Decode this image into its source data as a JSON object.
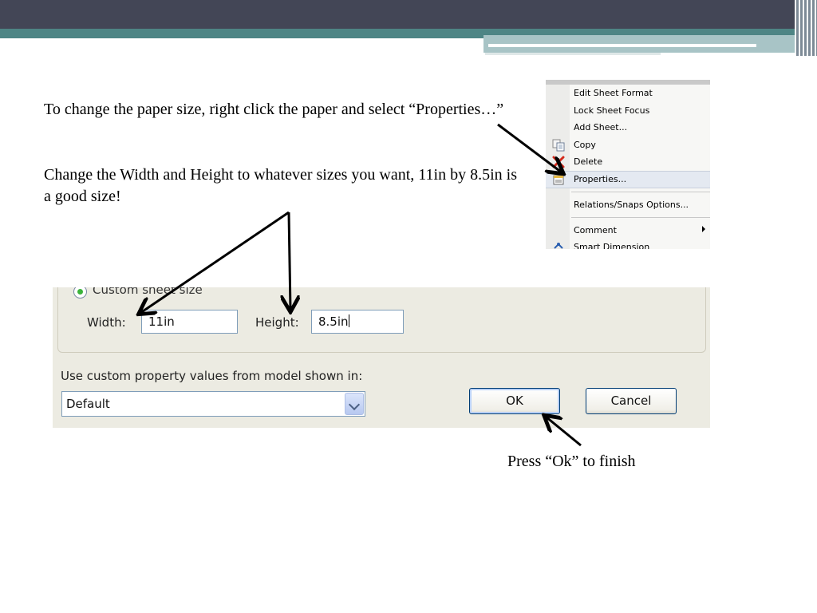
{
  "slide": {
    "instruction_1": "To change the paper size, right click the paper and select “Properties…”",
    "instruction_2": "Change the Width and Height to whatever sizes you want, 11in by 8.5in is a good size!",
    "instruction_3": "Press “Ok” to finish"
  },
  "context_menu": {
    "items": [
      {
        "label": "Edit Sheet Format",
        "icon": null
      },
      {
        "label": "Lock Sheet Focus",
        "icon": null
      },
      {
        "label": "Add Sheet...",
        "icon": null
      },
      {
        "label": "Copy",
        "icon": "copy-icon"
      },
      {
        "label": "Delete",
        "icon": "delete-icon"
      },
      {
        "label": "Properties...",
        "icon": "properties-icon",
        "highlighted": true
      },
      {
        "label": "Relations/Snaps Options...",
        "icon": null
      },
      {
        "label": "Comment",
        "icon": null,
        "submenu": true
      },
      {
        "label": "Smart Dimension",
        "icon": "smart-dimension-icon"
      }
    ]
  },
  "dialog": {
    "radio_label": "Custom sheet size",
    "width_label": "Width:",
    "width_value": "11in",
    "height_label": "Height:",
    "height_value": "8.5in",
    "model_label": "Use custom property values from model shown in:",
    "model_select_value": "Default",
    "ok_label": "OK",
    "cancel_label": "Cancel"
  },
  "colors": {
    "banner_dark": "#434656",
    "banner_teal": "#4e8585",
    "banner_light": "#a8c4c6",
    "dialog_bg": "#ecebe2",
    "menu_highlight": "#e4e9f1"
  }
}
